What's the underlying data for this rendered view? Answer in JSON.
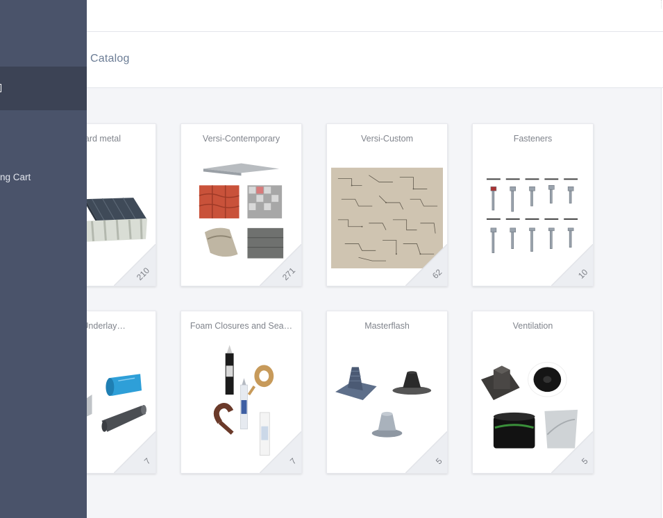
{
  "breadcrumb": {
    "label": "Catalog"
  },
  "sidebar": {
    "items": [
      {
        "label": ""
      },
      {
        "label": "ng Cart"
      }
    ]
  },
  "cards": [
    {
      "title": "andard metal",
      "count": "210",
      "image": "metal-roof-panels"
    },
    {
      "title": "Versi-Contemporary",
      "count": "271",
      "image": "roof-tiles"
    },
    {
      "title": "Versi-Custom",
      "count": "62",
      "image": "flashing-profiles-diagram"
    },
    {
      "title": "Fasteners",
      "count": "10",
      "image": "roofing-screws"
    },
    {
      "title": "and Underlay…",
      "count": "7",
      "image": "underlay-rolls"
    },
    {
      "title": "Foam Closures and Sea…",
      "count": "7",
      "image": "sealant-tubes"
    },
    {
      "title": "Masterflash",
      "count": "5",
      "image": "pipe-flashings"
    },
    {
      "title": "Ventilation",
      "count": "5",
      "image": "vent-products"
    }
  ],
  "colors": {
    "sidebar": "#4a536a",
    "sidebar_active": "#3c4355",
    "content_bg": "#f4f5f8",
    "breadcrumb_text": "#6b7c95"
  }
}
